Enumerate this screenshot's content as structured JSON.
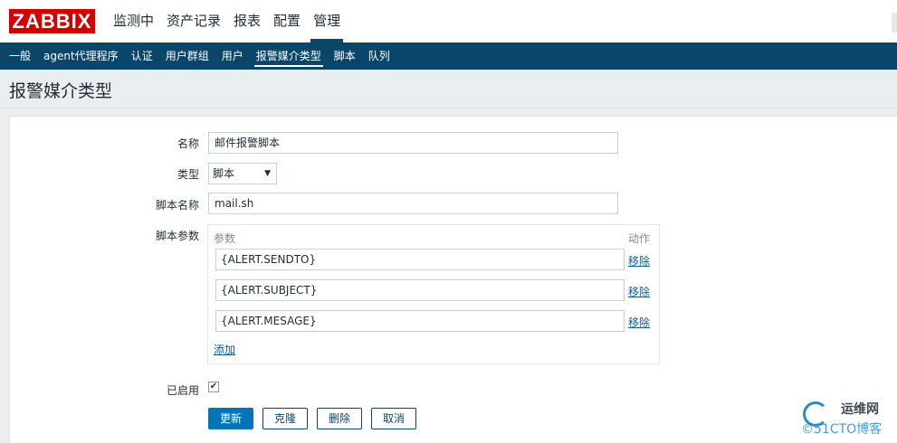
{
  "brand": {
    "logo_text": "ZABBIX",
    "color": "#d40000"
  },
  "top_nav": {
    "items": [
      {
        "label": "监测中"
      },
      {
        "label": "资产记录"
      },
      {
        "label": "报表"
      },
      {
        "label": "配置"
      },
      {
        "label": "管理",
        "active": true
      }
    ]
  },
  "sub_nav": {
    "items": [
      {
        "label": "一般"
      },
      {
        "label": "agent代理程序"
      },
      {
        "label": "认证"
      },
      {
        "label": "用户群组"
      },
      {
        "label": "用户"
      },
      {
        "label": "报警媒介类型",
        "active": true
      },
      {
        "label": "脚本"
      },
      {
        "label": "队列"
      }
    ]
  },
  "page": {
    "title": "报警媒介类型"
  },
  "form": {
    "name": {
      "label": "名称",
      "value": "邮件报警脚本"
    },
    "type": {
      "label": "类型",
      "value": "脚本"
    },
    "script_name": {
      "label": "脚本名称",
      "value": "mail.sh"
    },
    "script_params": {
      "label": "脚本参数",
      "col_param": "参数",
      "col_action": "动作",
      "rows": [
        {
          "value": "{ALERT.SENDTO}",
          "remove": "移除"
        },
        {
          "value": "{ALERT.SUBJECT}",
          "remove": "移除"
        },
        {
          "value": "{ALERT.MESAGE}",
          "remove": "移除"
        }
      ],
      "add": "添加"
    },
    "enabled": {
      "label": "已启用",
      "checked": true
    },
    "buttons": {
      "update": "更新",
      "clone": "克隆",
      "delete": "删除",
      "cancel": "取消"
    }
  },
  "watermark": {
    "top": "运维网",
    "bottom": "©51CTO博客"
  },
  "colors": {
    "nav_bg": "#0a466a",
    "primary_button": "#0275b8",
    "link": "#0a5b9a"
  }
}
